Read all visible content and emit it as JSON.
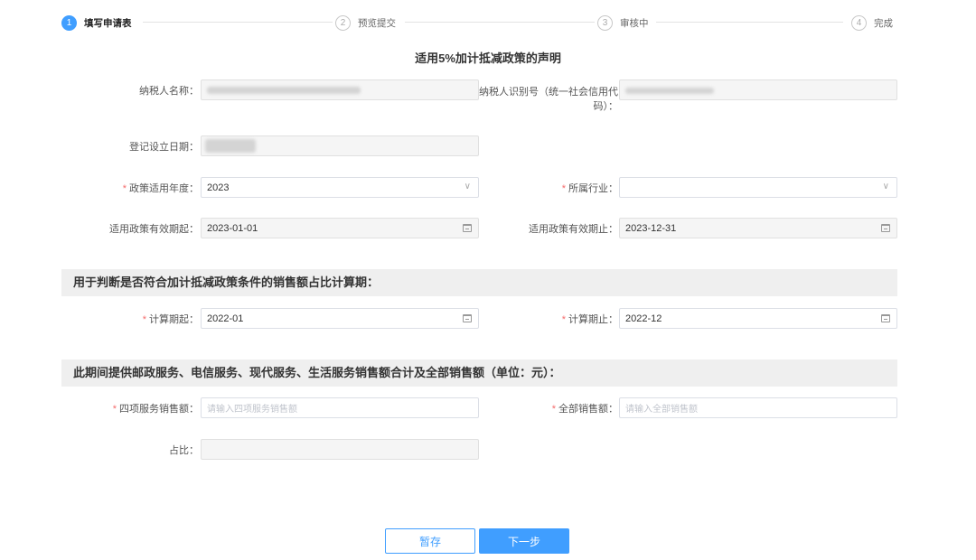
{
  "steps": [
    {
      "num": "1",
      "label": "填写申请表",
      "active": true
    },
    {
      "num": "2",
      "label": "预览提交",
      "active": false
    },
    {
      "num": "3",
      "label": "审核中",
      "active": false
    },
    {
      "num": "4",
      "label": "完成",
      "active": false
    }
  ],
  "title": "适用5%加计抵减政策的声明",
  "form": {
    "taxpayer_name_label": "纳税人名称：",
    "taxpayer_id_label_1": "纳税人识别号（统一社会信用代",
    "taxpayer_id_label_2": "码）：",
    "register_date_label": "登记设立日期：",
    "policy_year_label": "政策适用年度：",
    "policy_year_value": "2023",
    "industry_label": "所属行业：",
    "industry_value": "",
    "policy_start_label": "适用政策有效期起：",
    "policy_start_value": "2023-01-01",
    "policy_end_label": "适用政策有效期止：",
    "policy_end_value": "2023-12-31"
  },
  "section1": {
    "title": "用于判断是否符合加计抵减政策条件的销售额占比计算期：",
    "calc_start_label": "计算期起：",
    "calc_start_value": "2022-01",
    "calc_end_label": "计算期止：",
    "calc_end_value": "2022-12"
  },
  "section2": {
    "title": "此期间提供邮政服务、电信服务、现代服务、生活服务销售额合计及全部销售额（单位：元）：",
    "four_services_label": "四项服务销售额：",
    "four_services_placeholder": "请输入四项服务销售额",
    "total_sales_label": "全部销售额：",
    "total_sales_placeholder": "请输入全部销售额",
    "ratio_label": "占比："
  },
  "required_mark": "*",
  "buttons": {
    "save": "暂存",
    "next": "下一步"
  },
  "colors": {
    "accent": "#409eff",
    "required": "#f56c6c",
    "section_bg": "#efefef"
  },
  "icons": {
    "dropdown": "chevron-down-icon",
    "date": "calendar-icon"
  }
}
